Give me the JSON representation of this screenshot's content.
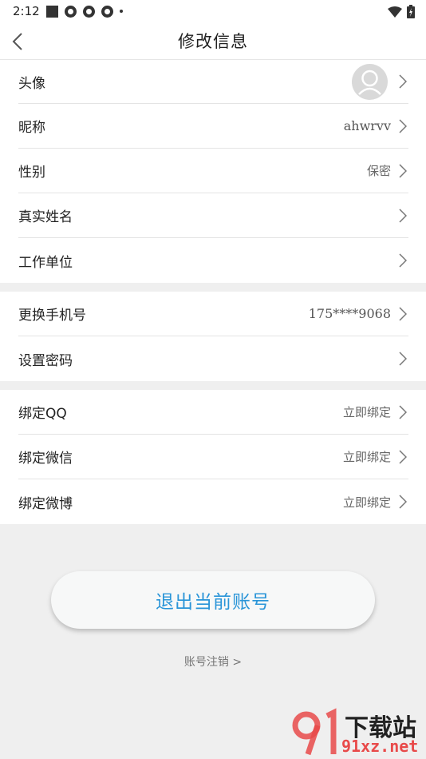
{
  "status_bar": {
    "time": "2:12"
  },
  "header": {
    "title": "修改信息"
  },
  "profile": [
    {
      "label": "头像",
      "value": ""
    },
    {
      "label": "昵称",
      "value": "ahwrvv"
    },
    {
      "label": "性别",
      "value": "保密"
    },
    {
      "label": "真实姓名",
      "value": ""
    },
    {
      "label": "工作单位",
      "value": ""
    }
  ],
  "account": [
    {
      "label": "更换手机号",
      "value": "175****9068"
    },
    {
      "label": "设置密码",
      "value": ""
    }
  ],
  "bindings": [
    {
      "label": "绑定QQ",
      "value": "立即绑定"
    },
    {
      "label": "绑定微信",
      "value": "立即绑定"
    },
    {
      "label": "绑定微博",
      "value": "立即绑定"
    }
  ],
  "logout_label": "退出当前账号",
  "cancel_account_label": "账号注销 >",
  "watermark": {
    "line1": "下载站",
    "line2": "91xz.net"
  },
  "colors": {
    "accent": "#2a95d8",
    "background": "#efefef",
    "watermark": "#e84a4a"
  }
}
